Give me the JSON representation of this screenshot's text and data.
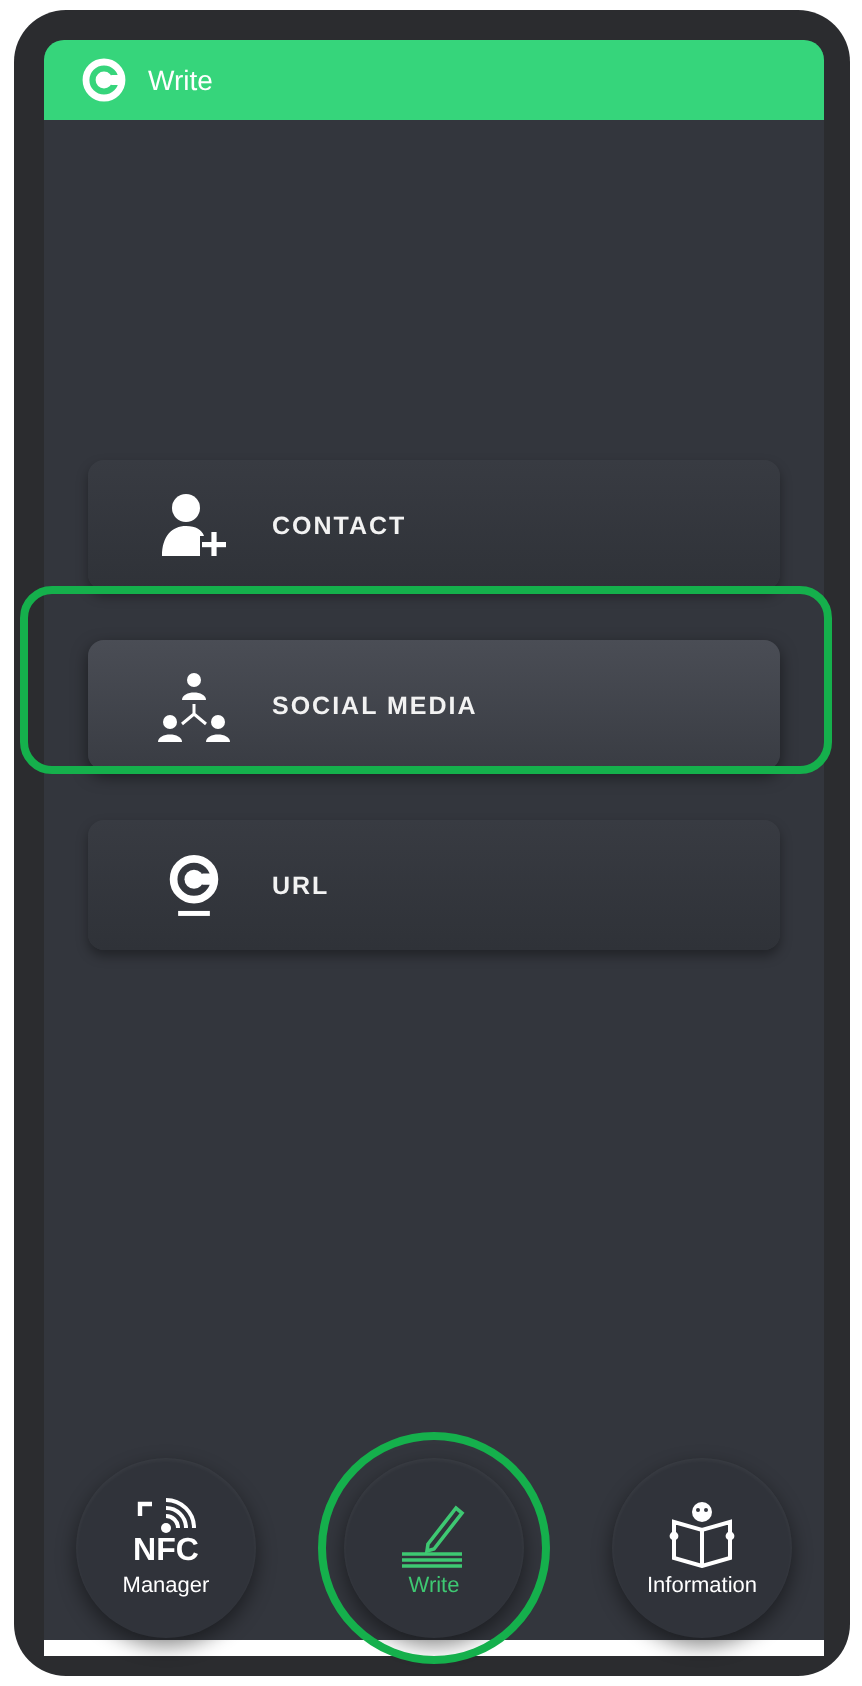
{
  "app_bar": {
    "title": "Write"
  },
  "options": [
    {
      "kind": "contact",
      "label": "CONTACT",
      "highlighted": false
    },
    {
      "kind": "social",
      "label": "SOCIAL MEDIA",
      "highlighted": true
    },
    {
      "kind": "url",
      "label": "URL",
      "highlighted": false
    }
  ],
  "bottom_nav": [
    {
      "kind": "nfc",
      "title": "NFC",
      "label": "Manager",
      "selected": false,
      "highlighted": false
    },
    {
      "kind": "write",
      "label": "Write",
      "selected": true,
      "highlighted": true
    },
    {
      "kind": "info",
      "label": "Information",
      "selected": false,
      "highlighted": false
    }
  ]
}
